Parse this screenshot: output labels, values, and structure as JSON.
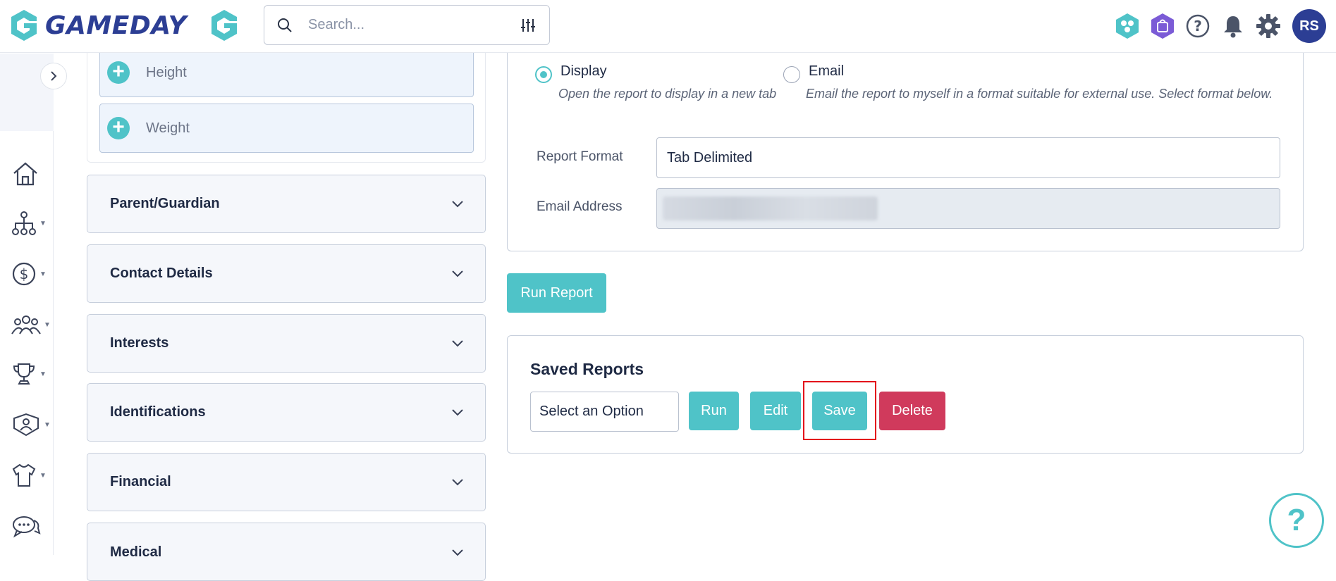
{
  "header": {
    "brand": "GAMEDAY",
    "search_placeholder": "Search...",
    "avatar_initials": "RS"
  },
  "sidebar": {
    "items": [
      {
        "icon": "home-icon"
      },
      {
        "icon": "hierarchy-icon"
      },
      {
        "icon": "dollar-icon"
      },
      {
        "icon": "people-icon"
      },
      {
        "icon": "trophy-icon"
      },
      {
        "icon": "team-icon"
      },
      {
        "icon": "jersey-icon"
      },
      {
        "icon": "chat-icon"
      }
    ]
  },
  "fields_panel": {
    "attributes": [
      "Height",
      "Weight"
    ],
    "sections": [
      "Parent/Guardian",
      "Contact Details",
      "Interests",
      "Identifications",
      "Financial",
      "Medical"
    ]
  },
  "output": {
    "display_label": "Display",
    "display_desc": "Open the report to display in a new tab",
    "email_label": "Email",
    "email_desc": "Email the report to myself in a format suitable for external use. Select format below.",
    "selected": "Display",
    "report_format_label": "Report Format",
    "report_format_value": "Tab Delimited",
    "email_address_label": "Email Address"
  },
  "run_report_label": "Run Report",
  "saved_reports": {
    "title": "Saved Reports",
    "select_value": "Select an Option",
    "run_label": "Run",
    "edit_label": "Edit",
    "save_label": "Save",
    "delete_label": "Delete"
  },
  "help_fab": "?",
  "colors": {
    "brand": "#2c3e94",
    "teal": "#4fc3c8",
    "danger": "#d03a5c",
    "highlight": "#e3131b"
  }
}
